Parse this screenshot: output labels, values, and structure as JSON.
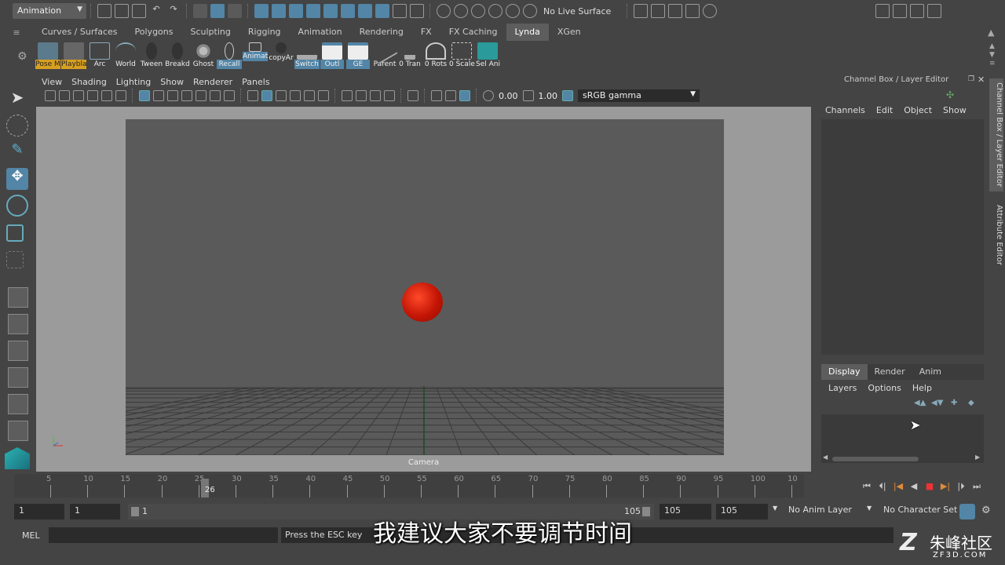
{
  "menu_mode": "Animation",
  "status_line": {
    "live_surface": "No Live Surface"
  },
  "shelf_tabs": [
    {
      "label": "Curves / Surfaces"
    },
    {
      "label": "Polygons"
    },
    {
      "label": "Sculpting"
    },
    {
      "label": "Rigging"
    },
    {
      "label": "Animation"
    },
    {
      "label": "Rendering"
    },
    {
      "label": "FX"
    },
    {
      "label": "FX Caching"
    },
    {
      "label": "Lynda",
      "active": true
    },
    {
      "label": "XGen"
    }
  ],
  "shelf_items": [
    "Pose M",
    "Playbla",
    "Arc",
    "World",
    "Tween",
    "Breakd",
    "Ghost",
    "Recall",
    "Animat",
    "copyAr",
    "Switch",
    "Outl",
    "GE",
    "Parent",
    "0 Tran",
    "0 Rots",
    "0 Scale",
    "Sel Ani"
  ],
  "viewport": {
    "menu": [
      "View",
      "Shading",
      "Lighting",
      "Show",
      "Renderer",
      "Panels"
    ],
    "exposure": "0.00",
    "gamma_value": "1.00",
    "color_space": "sRGB gamma",
    "camera_label": "Camera"
  },
  "channel_box": {
    "title": "Channel Box / Layer Editor",
    "menu": [
      "Channels",
      "Edit",
      "Object",
      "Show"
    ]
  },
  "layer_editor": {
    "tabs": [
      "Display",
      "Render",
      "Anim"
    ],
    "active_tab": "Display",
    "menu": [
      "Layers",
      "Options",
      "Help"
    ]
  },
  "side_tabs": [
    "Channel Box / Layer Editor",
    "Attribute Editor"
  ],
  "timeline": {
    "ticks": [
      "5",
      "10",
      "15",
      "20",
      "25",
      "30",
      "35",
      "40",
      "45",
      "50",
      "55",
      "60",
      "65",
      "70",
      "75",
      "80",
      "85",
      "90",
      "95",
      "100",
      "10"
    ],
    "current_frame": "26"
  },
  "range": {
    "start": "1",
    "playback_start": "1",
    "slider_start": "1",
    "slider_end": "105",
    "playback_end": "105",
    "end": "105",
    "anim_layer": "No Anim Layer",
    "character_set": "No Character Set"
  },
  "command_line": {
    "label": "MEL",
    "help": "Press the ESC key"
  },
  "subtitle": "我建议大家不要调节时间",
  "watermark": {
    "text": "朱峰社区",
    "url": "ZF3D.COM"
  },
  "colors": {
    "accent": "#5285a6",
    "ball": "#c41505"
  }
}
